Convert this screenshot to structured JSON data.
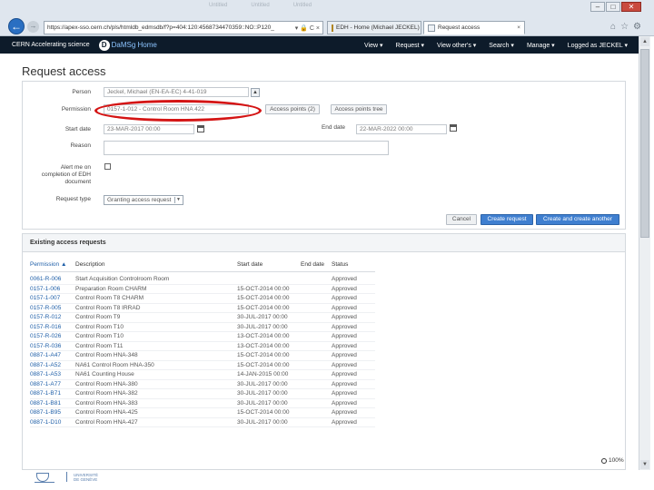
{
  "browser": {
    "window_controls": {
      "minimize": "–",
      "maximize": "□",
      "close": "✕"
    },
    "faint_tabs": [
      "Untitled",
      "Untitled",
      "Untitled"
    ],
    "address": "https://apex-sso.cern.ch/pls/htmldb_edmsdb/f?p=404:120:4568734470359::NO::P120_",
    "address_tools": "▾ 🔒 C ×",
    "tabs": [
      {
        "title": "EDH - Home (Michael JECKEL)",
        "active": false
      },
      {
        "title": "Request access",
        "active": true,
        "close": "×"
      }
    ]
  },
  "navbar": {
    "brand": "CERN Accelerating science",
    "logo_letter": "D",
    "app_name": "DaMSg Home",
    "items": [
      "View ▾",
      "Request ▾",
      "View other's ▾",
      "Search ▾",
      "Manage ▾",
      "Logged as JECKEL ▾"
    ]
  },
  "page": {
    "title": "Request access"
  },
  "form": {
    "person_label": "Person",
    "person_value": "Jeckel, Michael (EN-EA-EC) 4-41-019",
    "permission_label": "Permission",
    "permission_value": "0157-1-012 - Control Room HNA 422",
    "access_points_button": "Access points (2)",
    "access_points_tree_button": "Access points tree",
    "start_date_label": "Start date",
    "start_date_value": "23-MAR-2017 00:00",
    "end_date_label": "End date",
    "end_date_value": "22-MAR-2022 00:00",
    "reason_label": "Reason",
    "alert_label": "Alert me on completion of EDH document",
    "request_type_label": "Request type",
    "request_type_value": "Granting access request",
    "cancel_button": "Cancel",
    "create_button": "Create request",
    "create_another_button": "Create and create another"
  },
  "existing_requests": {
    "title": "Existing access requests",
    "columns": [
      "Permission ▲",
      "Description",
      "Start date",
      "End date",
      "Status"
    ],
    "rows": [
      [
        "0061-R-006",
        "Start Acquisition Controlroom Room",
        "",
        "",
        "Approved"
      ],
      [
        "0157-1-006",
        "Preparation Room CHARM",
        "15-OCT-2014 00:00",
        "",
        "Approved"
      ],
      [
        "0157-1-007",
        "Control Room T8 CHARM",
        "15-OCT-2014 00:00",
        "",
        "Approved"
      ],
      [
        "0157-R-005",
        "Control Room T8 IRRAD",
        "15-OCT-2014 00:00",
        "",
        "Approved"
      ],
      [
        "0157-R-012",
        "Control Room T9",
        "30-JUL-2017 00:00",
        "",
        "Approved"
      ],
      [
        "0157-R-016",
        "Control Room T10",
        "30-JUL-2017 00:00",
        "",
        "Approved"
      ],
      [
        "0157-R-026",
        "Control Room T10",
        "13-OCT-2014 00:00",
        "",
        "Approved"
      ],
      [
        "0157-R-036",
        "Control Room T11",
        "13-OCT-2014 00:00",
        "",
        "Approved"
      ],
      [
        "0887-1-A47",
        "Control Room HNA-348",
        "15-OCT-2014 00:00",
        "",
        "Approved"
      ],
      [
        "0887-1-A52",
        "NA61 Control Room HNA-350",
        "15-OCT-2014 00:00",
        "",
        "Approved"
      ],
      [
        "0887-1-A53",
        "NA61 Counting House",
        "14-JAN-2015 00:00",
        "",
        "Approved"
      ],
      [
        "0887-1-A77",
        "Control Room HNA-380",
        "30-JUL-2017 00:00",
        "",
        "Approved"
      ],
      [
        "0887-1-B71",
        "Control Room HNA-382",
        "30-JUL-2017 00:00",
        "",
        "Approved"
      ],
      [
        "0887-1-B81",
        "Control Room HNA-383",
        "30-JUL-2017 00:00",
        "",
        "Approved"
      ],
      [
        "0887-1-B95",
        "Control Room HNA-425",
        "15-OCT-2014 00:00",
        "",
        "Approved"
      ],
      [
        "0887-1-D10",
        "Control Room HNA-427",
        "30-JUL-2017 00:00",
        "",
        "Approved"
      ]
    ]
  },
  "footer": {
    "org_text": "UNIVERSITÉ DE GENÈVE",
    "zoom": "100%"
  }
}
